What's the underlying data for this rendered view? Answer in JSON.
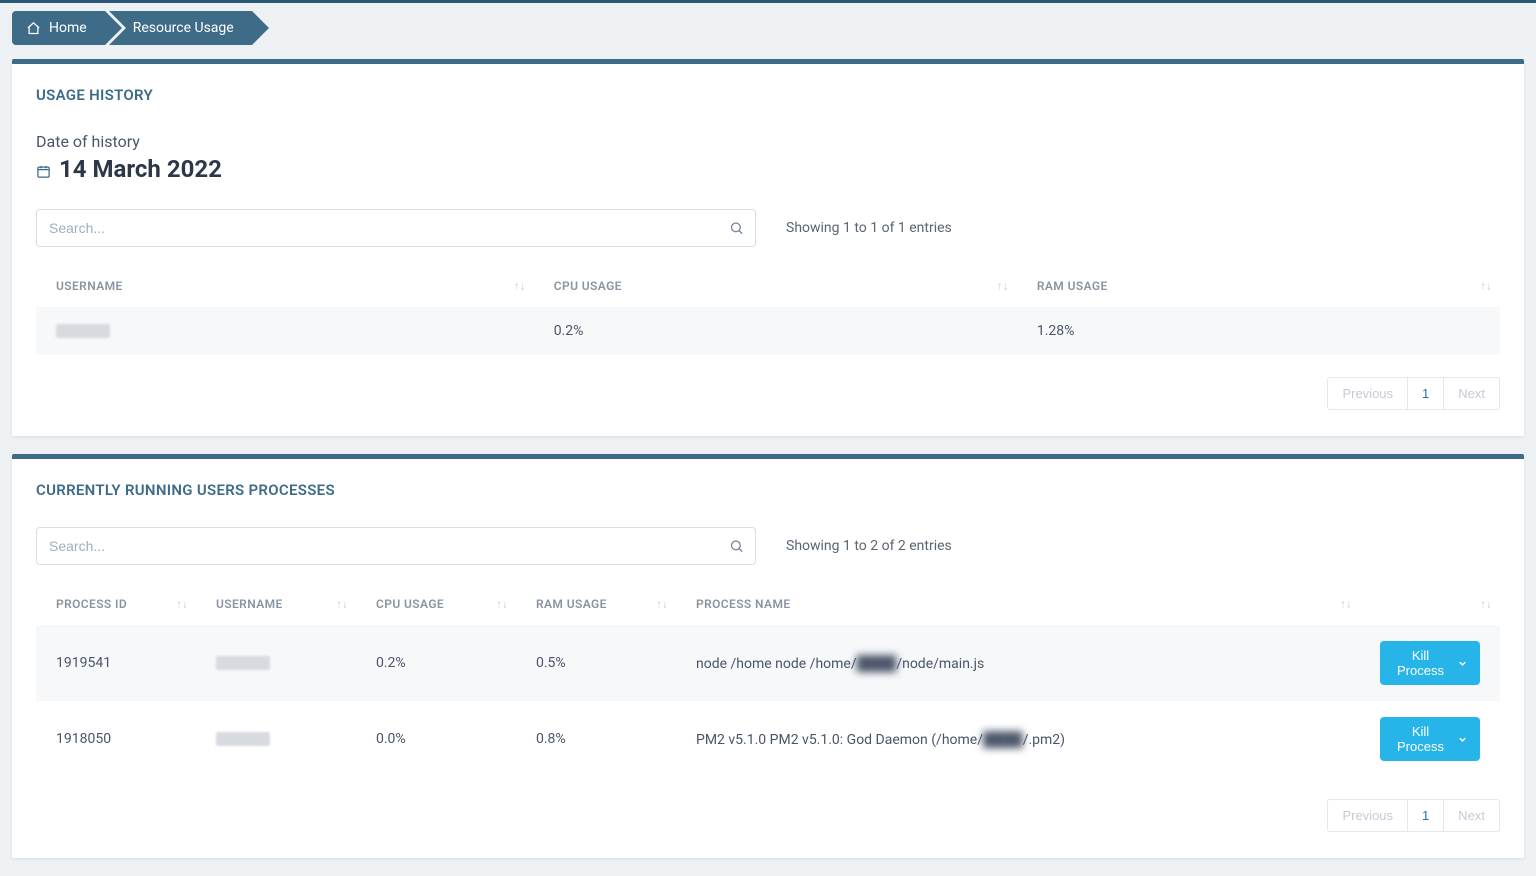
{
  "breadcrumb": {
    "home": "Home",
    "current": "Resource Usage"
  },
  "history": {
    "title": "USAGE HISTORY",
    "date_label": "Date of history",
    "date_value": "14 March 2022",
    "search_placeholder": "Search...",
    "entries_text": "Showing 1 to 1 of 1 entries",
    "columns": {
      "username": "USERNAME",
      "cpu": "CPU USAGE",
      "ram": "RAM USAGE"
    },
    "rows": [
      {
        "username": "██████",
        "cpu": "0.2%",
        "ram": "1.28%"
      }
    ],
    "pagination": {
      "previous": "Previous",
      "page": "1",
      "next": "Next"
    }
  },
  "processes": {
    "title": "CURRENTLY RUNNING USERS PROCESSES",
    "search_placeholder": "Search...",
    "entries_text": "Showing 1 to 2 of 2 entries",
    "columns": {
      "pid": "PROCESS ID",
      "username": "USERNAME",
      "cpu": "CPU USAGE",
      "ram": "RAM USAGE",
      "name": "PROCESS NAME",
      "actions": ""
    },
    "kill_label": "Kill Process",
    "rows": [
      {
        "pid": "1919541",
        "username": "██████",
        "cpu": "0.2%",
        "ram": "0.5%",
        "name_pre": "node /home node /home/",
        "name_blur": "████",
        "name_post": "/node/main.js"
      },
      {
        "pid": "1918050",
        "username": "██████",
        "cpu": "0.0%",
        "ram": "0.8%",
        "name_pre": "PM2 v5.1.0 PM2 v5.1.0: God Daemon (/home/",
        "name_blur": "████",
        "name_post": "/.pm2)"
      }
    ],
    "pagination": {
      "previous": "Previous",
      "page": "1",
      "next": "Next"
    }
  }
}
